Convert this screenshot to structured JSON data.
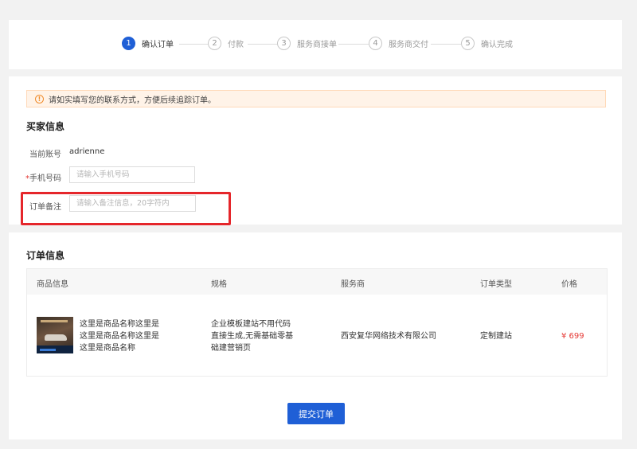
{
  "steps": [
    {
      "number": "1",
      "label": "确认订单"
    },
    {
      "number": "2",
      "label": "付款"
    },
    {
      "number": "3",
      "label": "服务商接单"
    },
    {
      "number": "4",
      "label": "服务商交付"
    },
    {
      "number": "5",
      "label": "确认完成"
    }
  ],
  "active_step": "1",
  "notice": {
    "icon": "info-icon",
    "text": "请如实填写您的联系方式，方便后续追踪订单。"
  },
  "buyer": {
    "title": "买家信息",
    "account_label": "当前账号",
    "account_value": "adrienne",
    "required_mark": "*",
    "phone_label": "手机号码",
    "phone_placeholder": "请输入手机号码",
    "remark_label": "订单备注",
    "remark_placeholder": "请输入备注信息，20字符内"
  },
  "order": {
    "title": "订单信息",
    "columns": [
      "商品信息",
      "规格",
      "服务商",
      "订单类型",
      "价格"
    ],
    "rows": [
      {
        "product_lines": [
          "这里是商品名称这里是",
          "这里是商品名称这里是",
          "这里是商品名称"
        ],
        "spec_lines": [
          "企业模板建站不用代码",
          "直接生成,无需基础零基",
          "础建营销页"
        ],
        "provider": "西安复华网络技术有限公司",
        "order_type": "定制建站",
        "price": "¥ 699"
      }
    ]
  },
  "submit_label": "提交订单",
  "colors": {
    "primary": "#1f5fd6",
    "price": "#e53935",
    "notice_bg": "#fff3e8",
    "highlight": "#e5262b"
  }
}
